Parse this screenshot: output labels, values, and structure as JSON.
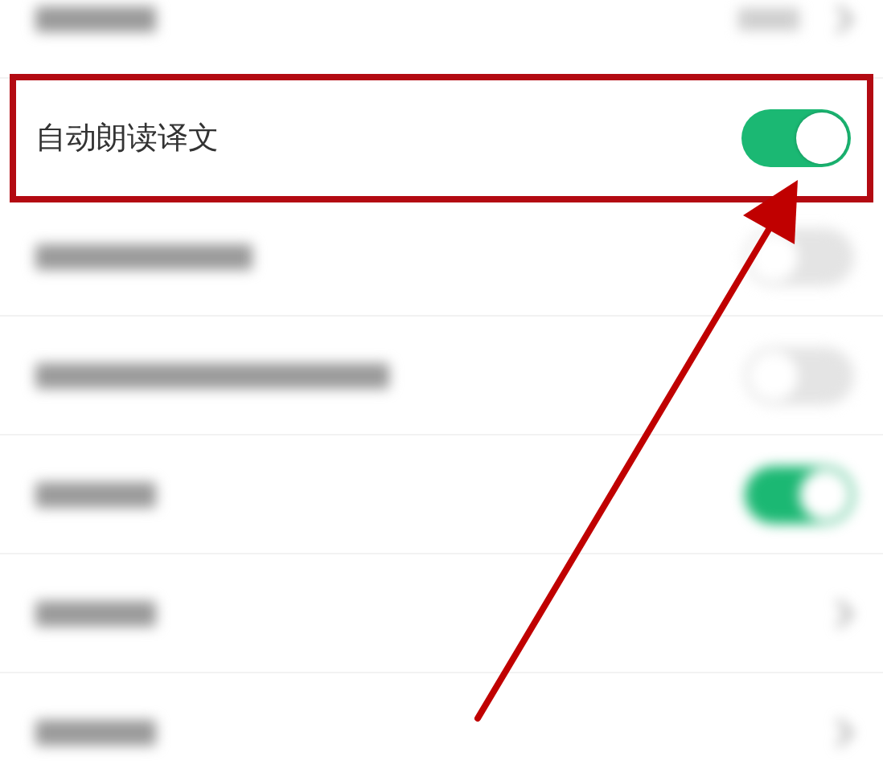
{
  "rows": [
    {
      "kind": "link_value",
      "blurred": true,
      "highlighted": false
    },
    {
      "kind": "toggle",
      "label": "自动朗读译文",
      "on": true,
      "blurred": false,
      "highlighted": true
    },
    {
      "kind": "toggle",
      "on": false,
      "blurred": true,
      "highlighted": false
    },
    {
      "kind": "toggle",
      "on": false,
      "blurred": true,
      "highlighted": false
    },
    {
      "kind": "toggle",
      "on": true,
      "blurred": true,
      "highlighted": false
    },
    {
      "kind": "link",
      "blurred": true,
      "highlighted": false
    },
    {
      "kind": "link",
      "blurred": true,
      "highlighted": false
    }
  ],
  "annotation": {
    "kind": "arrow"
  }
}
